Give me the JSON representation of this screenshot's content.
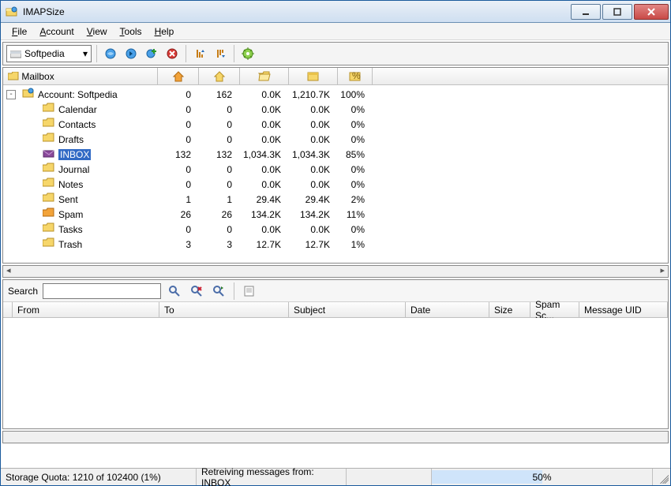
{
  "window": {
    "title": "IMAPSize"
  },
  "menu": {
    "file": "File",
    "account": "Account",
    "view": "View",
    "tools": "Tools",
    "help": "Help"
  },
  "toolbar": {
    "account_selected": "Softpedia"
  },
  "tree": {
    "header_label": "Mailbox",
    "root_label": "Account: Softpedia",
    "root_values": {
      "c1": "0",
      "c2": "162",
      "c3": "0.0K",
      "c4": "1,210.7K",
      "c5": "100%"
    },
    "rows": [
      {
        "name": "Calendar",
        "type": "folder",
        "c1": "0",
        "c2": "0",
        "c3": "0.0K",
        "c4": "0.0K",
        "c5": "0%",
        "selected": false
      },
      {
        "name": "Contacts",
        "type": "folder",
        "c1": "0",
        "c2": "0",
        "c3": "0.0K",
        "c4": "0.0K",
        "c5": "0%",
        "selected": false
      },
      {
        "name": "Drafts",
        "type": "folder",
        "c1": "0",
        "c2": "0",
        "c3": "0.0K",
        "c4": "0.0K",
        "c5": "0%",
        "selected": false
      },
      {
        "name": "INBOX",
        "type": "inbox",
        "c1": "132",
        "c2": "132",
        "c3": "1,034.3K",
        "c4": "1,034.3K",
        "c5": "85%",
        "selected": true
      },
      {
        "name": "Journal",
        "type": "folder",
        "c1": "0",
        "c2": "0",
        "c3": "0.0K",
        "c4": "0.0K",
        "c5": "0%",
        "selected": false
      },
      {
        "name": "Notes",
        "type": "folder",
        "c1": "0",
        "c2": "0",
        "c3": "0.0K",
        "c4": "0.0K",
        "c5": "0%",
        "selected": false
      },
      {
        "name": "Sent",
        "type": "folder",
        "c1": "1",
        "c2": "1",
        "c3": "29.4K",
        "c4": "29.4K",
        "c5": "2%",
        "selected": false
      },
      {
        "name": "Spam",
        "type": "spam",
        "c1": "26",
        "c2": "26",
        "c3": "134.2K",
        "c4": "134.2K",
        "c5": "11%",
        "selected": false
      },
      {
        "name": "Tasks",
        "type": "folder",
        "c1": "0",
        "c2": "0",
        "c3": "0.0K",
        "c4": "0.0K",
        "c5": "0%",
        "selected": false
      },
      {
        "name": "Trash",
        "type": "folder",
        "c1": "3",
        "c2": "3",
        "c3": "12.7K",
        "c4": "12.7K",
        "c5": "1%",
        "selected": false
      }
    ]
  },
  "search": {
    "label": "Search",
    "value": ""
  },
  "msg_cols": {
    "from": "From",
    "to": "To",
    "subject": "Subject",
    "date": "Date",
    "size": "Size",
    "spam": "Spam Sc...",
    "uid": "Message UID"
  },
  "status": {
    "quota": "Storage Quota: 1210 of 102400 (1%)",
    "retrieve": "Retreiving messages from: INBOX",
    "progress_text": "50%",
    "progress_pct": 50
  },
  "icons": {
    "expander": "-"
  }
}
